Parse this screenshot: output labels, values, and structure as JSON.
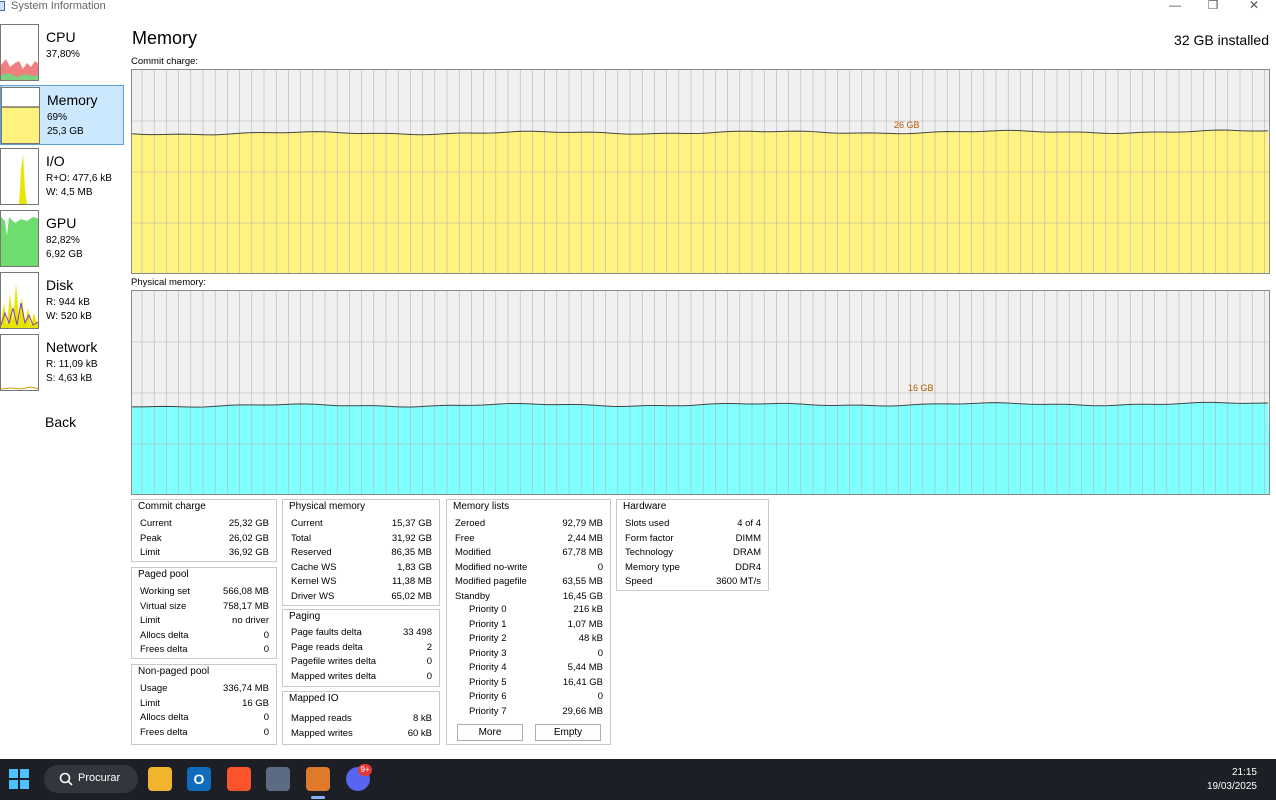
{
  "window": {
    "title": "System Information"
  },
  "sidebar": {
    "items": [
      {
        "name": "CPU",
        "line1": "37,80%",
        "line2": ""
      },
      {
        "name": "Memory",
        "line1": "69%",
        "line2": "25,3 GB"
      },
      {
        "name": "I/O",
        "line1": "R+O: 477,6 kB",
        "line2": "W: 4,5 MB"
      },
      {
        "name": "GPU",
        "line1": "82,82%",
        "line2": "6,92 GB"
      },
      {
        "name": "Disk",
        "line1": "R: 944 kB",
        "line2": "W: 520 kB"
      },
      {
        "name": "Network",
        "line1": "R: 11,09 kB",
        "line2": "S: 4,63 kB"
      }
    ],
    "back": "Back"
  },
  "main": {
    "title": "Memory",
    "installed": "32 GB installed",
    "commit_graph": {
      "label": "Commit charge:",
      "marker": "26 GB",
      "level": 0.69,
      "color": "#fff27f"
    },
    "physical_graph": {
      "label": "Physical memory:",
      "marker": "16 GB",
      "level": 0.44,
      "color": "#80ffff"
    }
  },
  "panels": {
    "commit_charge": {
      "title": "Commit charge",
      "rows": [
        [
          "Current",
          "25,32 GB"
        ],
        [
          "Peak",
          "26,02 GB"
        ],
        [
          "Limit",
          "36,92 GB"
        ]
      ]
    },
    "paged_pool": {
      "title": "Paged pool",
      "rows": [
        [
          "Working set",
          "566,08 MB"
        ],
        [
          "Virtual size",
          "758,17 MB"
        ],
        [
          "Limit",
          "no driver"
        ],
        [
          "Allocs delta",
          "0"
        ],
        [
          "Frees delta",
          "0"
        ]
      ]
    },
    "non_paged_pool": {
      "title": "Non-paged pool",
      "rows": [
        [
          "Usage",
          "336,74 MB"
        ],
        [
          "Limit",
          "16 GB"
        ],
        [
          "Allocs delta",
          "0"
        ],
        [
          "Frees delta",
          "0"
        ]
      ]
    },
    "physical_memory": {
      "title": "Physical memory",
      "rows": [
        [
          "Current",
          "15,37 GB"
        ],
        [
          "Total",
          "31,92 GB"
        ],
        [
          "Reserved",
          "86,35 MB"
        ],
        [
          "Cache WS",
          "1,83 GB"
        ],
        [
          "Kernel WS",
          "11,38 MB"
        ],
        [
          "Driver WS",
          "65,02 MB"
        ]
      ]
    },
    "paging": {
      "title": "Paging",
      "rows": [
        [
          "Page faults delta",
          "33 498"
        ],
        [
          "Page reads delta",
          "2"
        ],
        [
          "Pagefile writes delta",
          "0"
        ],
        [
          "Mapped writes delta",
          "0"
        ]
      ]
    },
    "mapped_io": {
      "title": "Mapped IO",
      "rows": [
        [
          "Mapped reads",
          "8 kB"
        ],
        [
          "Mapped writes",
          "60 kB"
        ]
      ]
    },
    "memory_lists": {
      "title": "Memory lists",
      "rows": [
        [
          "Zeroed",
          "92,79 MB"
        ],
        [
          "Free",
          "2,44 MB"
        ],
        [
          "Modified",
          "67,78 MB"
        ],
        [
          "Modified no-write",
          "0"
        ],
        [
          "Modified pagefile",
          "63,55 MB"
        ],
        [
          "Standby",
          "16,45 GB"
        ]
      ],
      "priorities": [
        [
          "Priority 0",
          "216 kB"
        ],
        [
          "Priority 1",
          "1,07 MB"
        ],
        [
          "Priority 2",
          "48 kB"
        ],
        [
          "Priority 3",
          "0"
        ],
        [
          "Priority 4",
          "5,44 MB"
        ],
        [
          "Priority 5",
          "16,41 GB"
        ],
        [
          "Priority 6",
          "0"
        ],
        [
          "Priority 7",
          "29,66 MB"
        ]
      ],
      "more_label": "More",
      "empty_label": "Empty"
    },
    "hardware": {
      "title": "Hardware",
      "rows": [
        [
          "Slots used",
          "4 of 4"
        ],
        [
          "Form factor",
          "DIMM"
        ],
        [
          "Technology",
          "DRAM"
        ],
        [
          "Memory type",
          "DDR4"
        ],
        [
          "Speed",
          "3600 MT/s"
        ]
      ]
    }
  },
  "taskbar": {
    "search_label": "Procurar",
    "time": "21:15",
    "date": "19/03/2025",
    "discord_badge": "9+"
  }
}
